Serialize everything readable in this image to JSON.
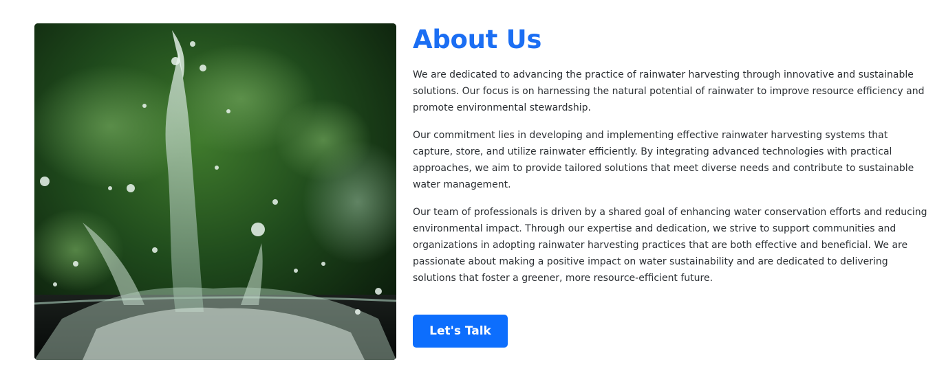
{
  "about": {
    "title": "About Us",
    "paragraphs": [
      "We are dedicated to advancing the practice of rainwater harvesting through innovative and sustainable solutions. Our focus is on harnessing the natural potential of rainwater to improve resource efficiency and promote environmental stewardship.",
      "Our commitment lies in developing and implementing effective rainwater harvesting systems that capture, store, and utilize rainwater efficiently. By integrating advanced technologies with practical approaches, we aim to provide tailored solutions that meet diverse needs and contribute to sustainable water management.",
      "Our team of professionals is driven by a shared goal of enhancing water conservation efforts and reducing environmental impact. Through our expertise and dedication, we strive to support communities and organizations in adopting rainwater harvesting practices that are both effective and beneficial. We are passionate about making a positive impact on water sustainability and are dedicated to delivering solutions that foster a greener, more resource-efficient future."
    ],
    "cta_label": "Let's Talk"
  },
  "colors": {
    "accent": "#0d6efd",
    "title": "#1b6ef3",
    "text": "#2b2f33",
    "background": "#ffffff"
  },
  "image": {
    "subject": "water-splash-photo"
  }
}
